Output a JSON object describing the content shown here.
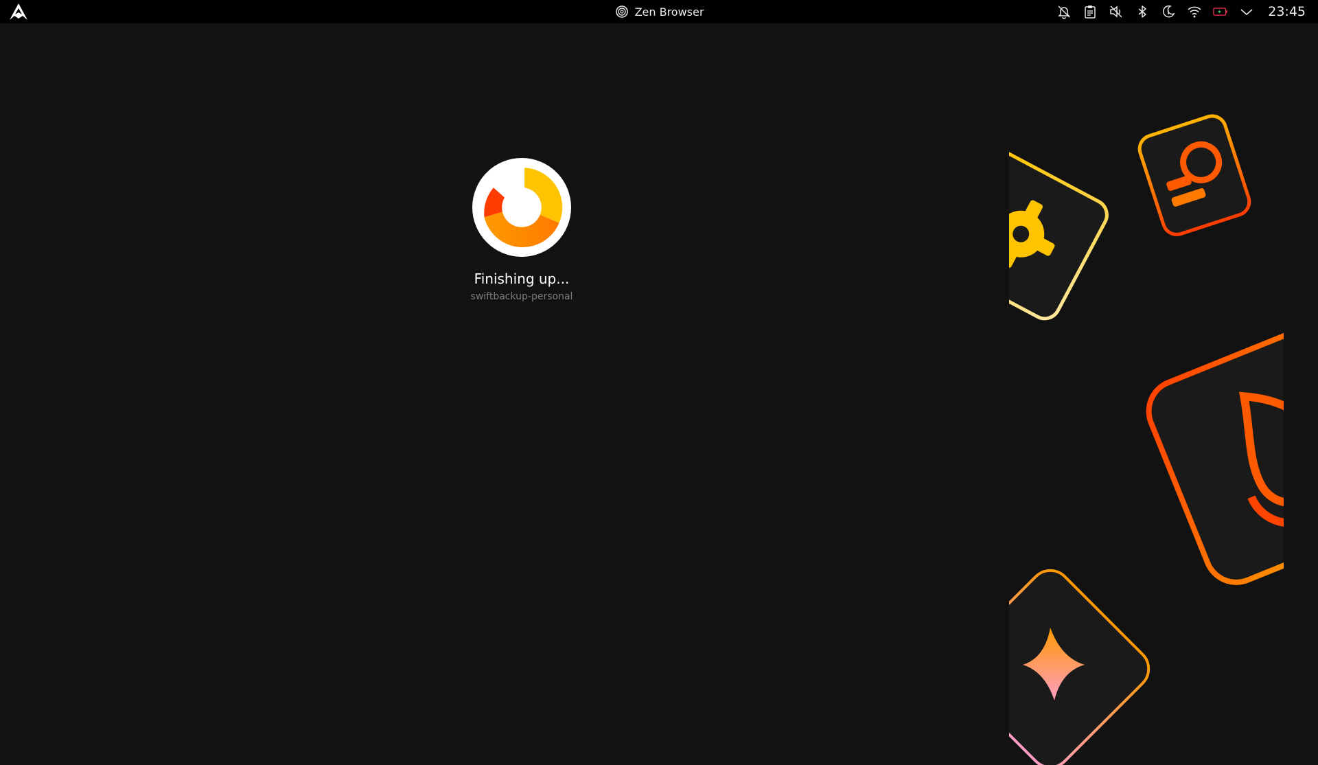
{
  "topbar": {
    "app_title": "Zen Browser",
    "clock": "23:45",
    "tray_icons": [
      "notifications-muted-icon",
      "clipboard-icon",
      "volume-muted-icon",
      "bluetooth-icon",
      "night-light-icon",
      "wifi-icon",
      "battery-icon",
      "chevron-down-icon"
    ]
  },
  "progress": {
    "status": "Finishing up...",
    "subtitle": "swiftbackup-personal"
  },
  "colors": {
    "background": "#121212",
    "topbar": "#000000",
    "accent_orange": "#ff8a00",
    "accent_red": "#ff3d00",
    "accent_yellow": "#ffc400"
  }
}
